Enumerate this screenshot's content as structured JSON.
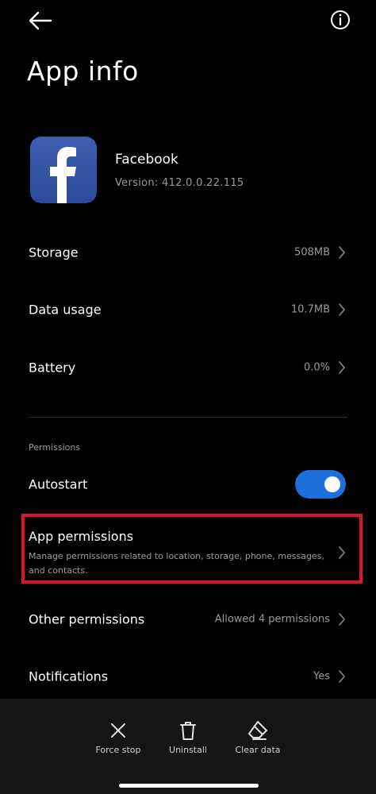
{
  "header": {
    "title": "App info",
    "back_icon": "arrow-left-icon",
    "info_icon": "info-circle-icon"
  },
  "app": {
    "name": "Facebook",
    "version": "Version: 412.0.0.22.115",
    "icon": "facebook-logo",
    "icon_color": "#3d5fb0"
  },
  "rows": {
    "storage": {
      "label": "Storage",
      "value": "508MB"
    },
    "data_usage": {
      "label": "Data usage",
      "value": "10.7MB"
    },
    "battery": {
      "label": "Battery",
      "value": "0.0%"
    }
  },
  "permissions_section": {
    "title": "Permissions",
    "autostart": {
      "label": "Autostart",
      "enabled": true,
      "accent": "#1e6fd9"
    },
    "app_permissions": {
      "label": "App permissions",
      "description": "Manage permissions related to location, storage, phone, messages, and contacts.",
      "highlight_color": "#d9142b"
    },
    "other_permissions": {
      "label": "Other permissions",
      "value": "Allowed 4 permissions"
    },
    "notifications": {
      "label": "Notifications",
      "value": "Yes"
    }
  },
  "actions": {
    "force_stop": {
      "label": "Force stop",
      "icon": "x-icon"
    },
    "uninstall": {
      "label": "Uninstall",
      "icon": "trash-icon"
    },
    "clear_data": {
      "label": "Clear data",
      "icon": "eraser-icon"
    }
  }
}
